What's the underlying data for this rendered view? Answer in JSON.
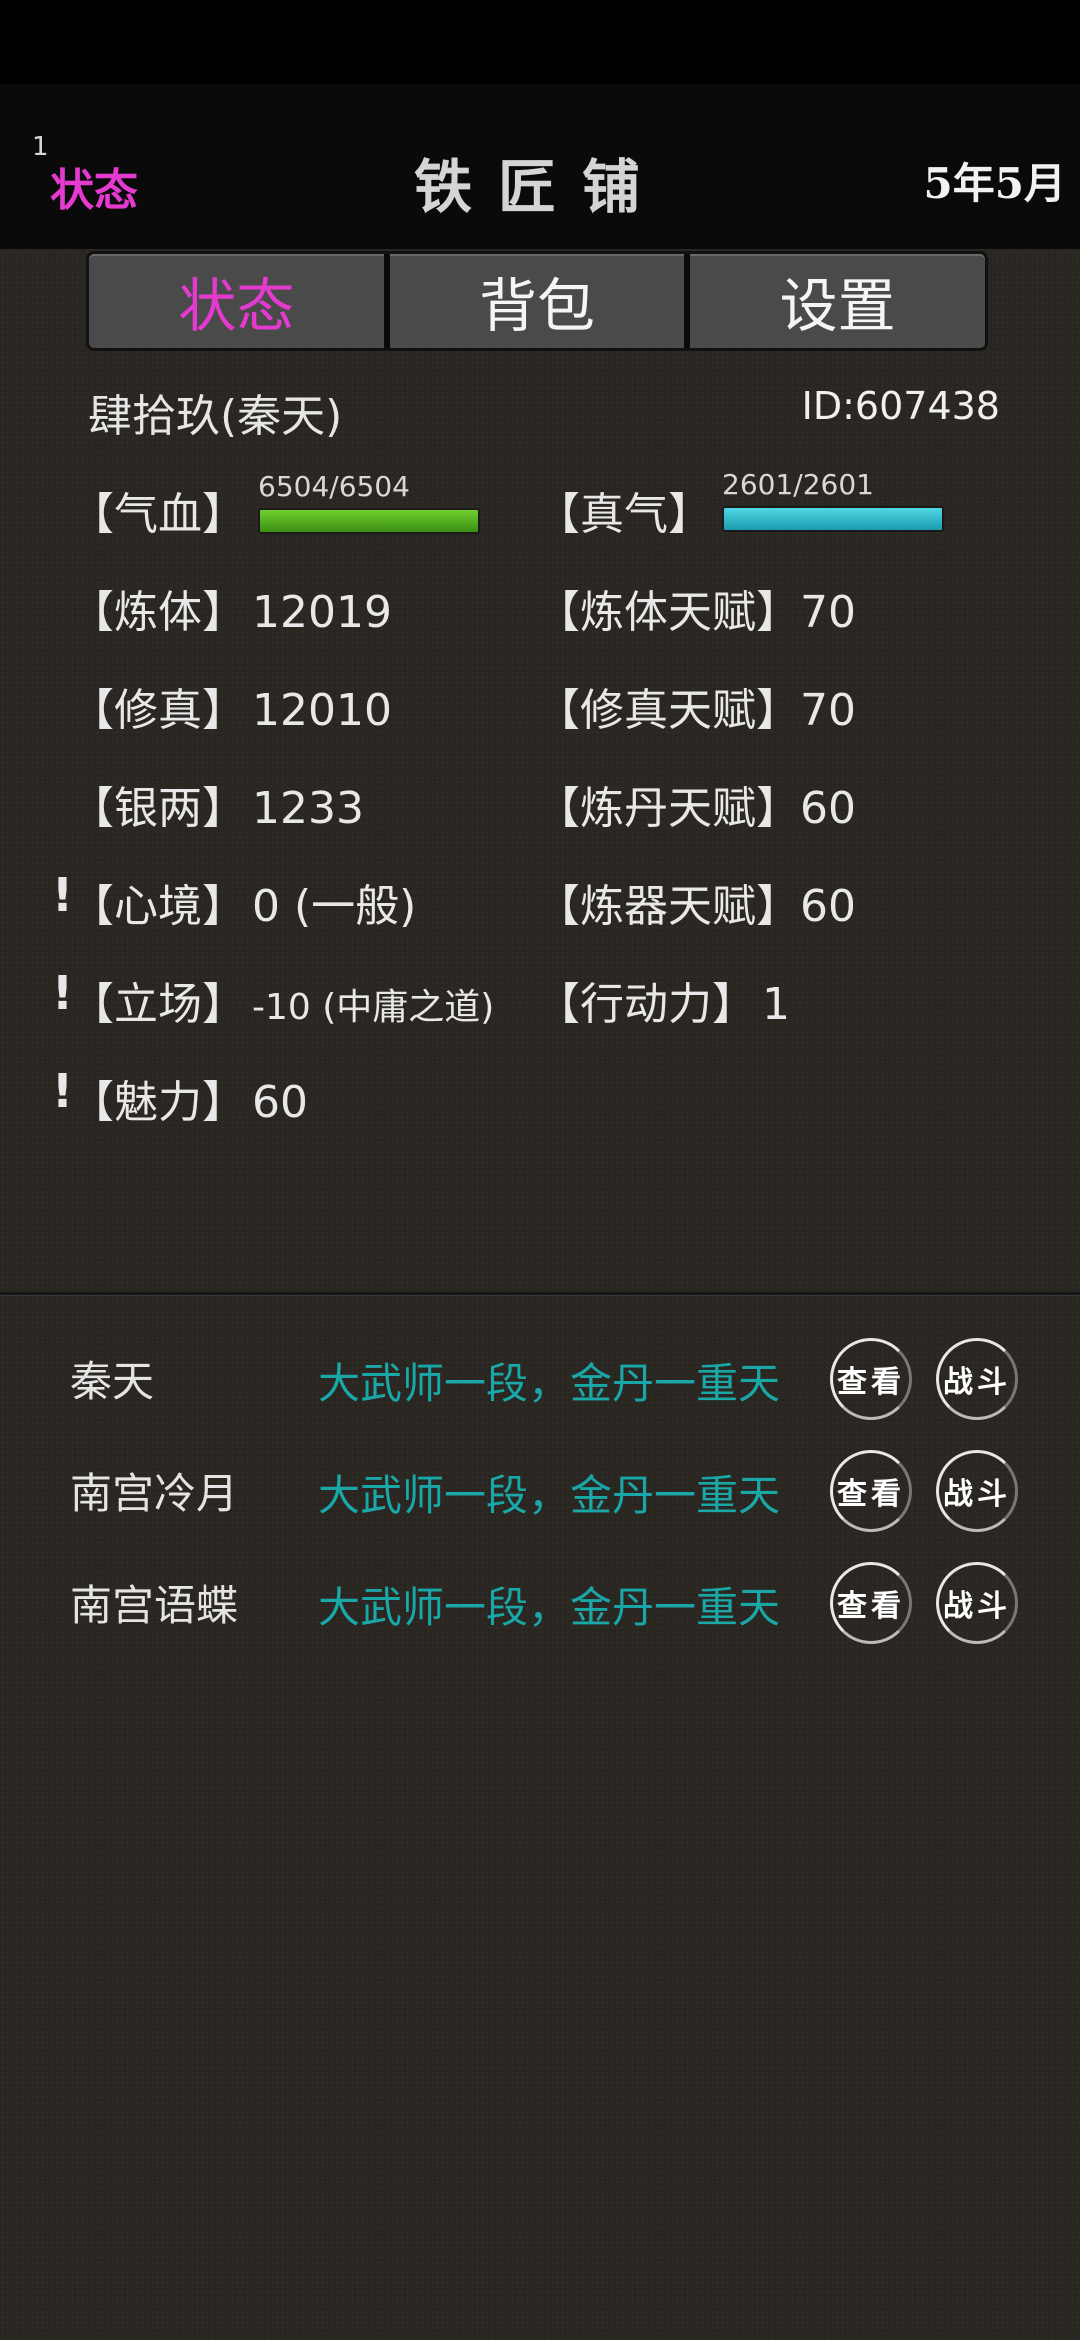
{
  "header": {
    "index": "1",
    "state_label": "状态",
    "title": "铁匠铺",
    "date": "5年5月"
  },
  "tabs": [
    {
      "label": "状态",
      "active": true
    },
    {
      "label": "背包",
      "active": false
    },
    {
      "label": "设置",
      "active": false
    }
  ],
  "player": {
    "name": "肆拾玖(秦天)",
    "id": "ID:607438"
  },
  "bars": {
    "hp": {
      "label": "【气血】",
      "text": "6504/6504",
      "fraction": 1.0,
      "color": "#4fae1e"
    },
    "mp": {
      "label": "【真气】",
      "text": "2601/2601",
      "fraction": 1.0,
      "color": "#24b4c4"
    }
  },
  "stats_left": [
    {
      "label": "【炼体】",
      "value": "12019"
    },
    {
      "label": "【修真】",
      "value": "12010"
    },
    {
      "label": "【银两】",
      "value": "1233"
    },
    {
      "label": "【心境】",
      "value": "0 (一般)",
      "alert": "!"
    },
    {
      "label": "【立场】",
      "value": "-10 (中庸之道)",
      "alert": "!"
    },
    {
      "label": "【魅力】",
      "value": "60",
      "alert": "!"
    }
  ],
  "stats_right": [
    {
      "label": "【炼体天赋】",
      "value": "70"
    },
    {
      "label": "【修真天赋】",
      "value": "70"
    },
    {
      "label": "【炼丹天赋】",
      "value": "60"
    },
    {
      "label": "【炼器天赋】",
      "value": "60"
    },
    {
      "label": "【行动力】",
      "value": "1"
    }
  ],
  "npcs": [
    {
      "name": "秦天",
      "rank": "大武师一段，金丹一重天",
      "view": "查看",
      "fight": "战斗"
    },
    {
      "name": "南宫冷月",
      "rank": "大武师一段，金丹一重天",
      "view": "查看",
      "fight": "战斗"
    },
    {
      "name": "南宫语蝶",
      "rank": "大武师一段，金丹一重天",
      "view": "查看",
      "fight": "战斗"
    }
  ],
  "colors": {
    "accent": "#e53ad0",
    "rank_text": "#1aa7a7"
  }
}
